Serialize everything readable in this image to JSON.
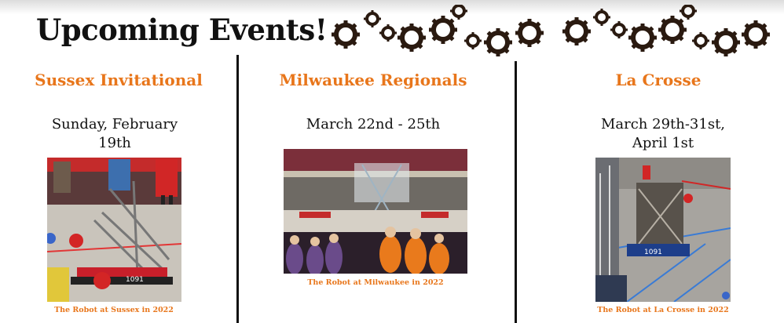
{
  "title": "Upcoming Events!",
  "events": [
    {
      "name": "Sussex Invitational",
      "date": "Sunday, February 19th",
      "caption": "The Robot at Sussex in 2022",
      "photo_icon": "robot-photo-icon"
    },
    {
      "name": "Milwaukee Regionals",
      "date": "March 22nd - 25th",
      "caption": "The Robot at Milwaukee in 2022",
      "photo_icon": "arena-photo-icon"
    },
    {
      "name": "La Crosse",
      "date": "March 29th-31st, April 1st",
      "caption": "The Robot at La Crosse in 2022",
      "photo_icon": "robot-photo-icon"
    }
  ],
  "colors": {
    "accent": "#e8761b",
    "text": "#111111",
    "divider": "#111111"
  },
  "decoration": {
    "icon": "gears-icon"
  }
}
